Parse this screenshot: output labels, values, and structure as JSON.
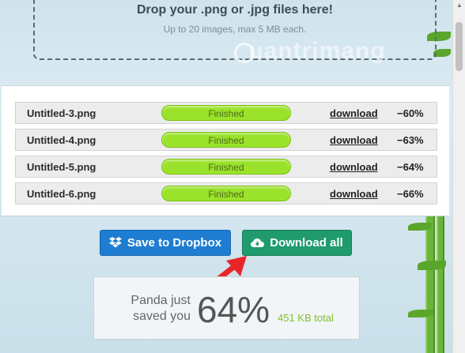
{
  "dropzone": {
    "title": "Drop your .png or .jpg files here!",
    "subtitle": "Up to 20 images, max 5 MB each."
  },
  "watermark": {
    "text": "uantrimang"
  },
  "files": [
    {
      "name": "Untitled-3.png",
      "status": "Finished",
      "progress": 1.0,
      "link": "download",
      "saving": "−60%"
    },
    {
      "name": "Untitled-4.png",
      "status": "Finished",
      "progress": 1.0,
      "link": "download",
      "saving": "−63%"
    },
    {
      "name": "Untitled-5.png",
      "status": "Finished",
      "progress": 1.0,
      "link": "download",
      "saving": "−64%"
    },
    {
      "name": "Untitled-6.png",
      "status": "Finished",
      "progress": 1.0,
      "link": "download",
      "saving": "−66%"
    }
  ],
  "buttons": {
    "dropbox": {
      "label": "Save to Dropbox",
      "icon": "dropbox-icon",
      "color": "#1e7dd1"
    },
    "download_all": {
      "label": "Download all",
      "icon": "cloud-download-icon",
      "color": "#1f9b6e"
    }
  },
  "summary": {
    "prefix": "Panda just saved you",
    "percent": "64%",
    "total": "451 KB total"
  },
  "colors": {
    "progress": "#9ae32a",
    "accent_arrow": "#e8262a",
    "total_text": "#7fbf2d"
  }
}
